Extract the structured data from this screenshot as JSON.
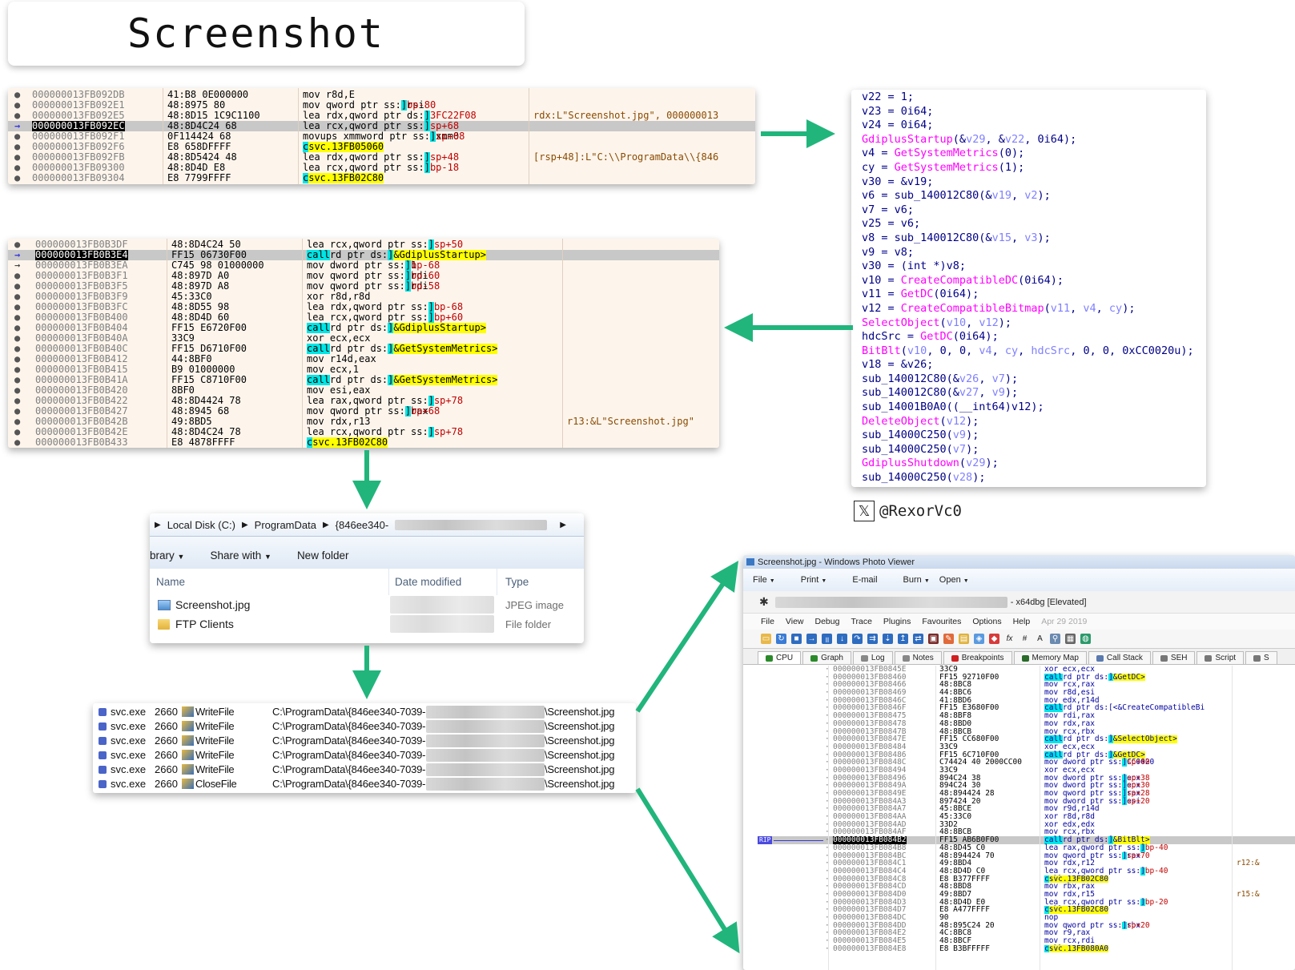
{
  "title": "Screenshot",
  "colors": {
    "arrow": "#21b57c",
    "cyan_highlight": "#00e5e5",
    "yellow_highlight": "#ffff00",
    "func_magenta": "#ff00ff",
    "var_blue": "#8080ff"
  },
  "debugger_top": {
    "rows": [
      {
        "addr": "000000013FB092DB",
        "bytes": "41:B8 0E000000",
        "ins": "mov r8d,E",
        "cmt": ""
      },
      {
        "addr": "000000013FB092E1",
        "bytes": "48:8975 80",
        "ins": "mov qword ptr ss:[rbp-80],rsi",
        "cmt": ""
      },
      {
        "addr": "000000013FB092E5",
        "bytes": "48:8D15 1C9C1100",
        "ins": "lea rdx,qword ptr ds:[13FC22F08]",
        "cmt": "rdx:L\"Screenshot.jpg\", 000000013"
      },
      {
        "addr": "000000013FB092EC",
        "bytes": "48:8D4C24 68",
        "ins": "lea rcx,qword ptr ss:[rsp+68]",
        "cmt": ""
      },
      {
        "addr": "000000013FB092F1",
        "bytes": "0F114424 68",
        "ins": "movups xmmword ptr ss:[rsp+68],xmm0",
        "cmt": ""
      },
      {
        "addr": "000000013FB092F6",
        "bytes": "E8 658DFFFF",
        "ins": "call svc.13FB05060",
        "cmt": ""
      },
      {
        "addr": "000000013FB092FB",
        "bytes": "48:8D5424 48",
        "ins": "lea rdx,qword ptr ss:[rsp+48]",
        "cmt": "[rsp+48]:L\"C:\\\\ProgramData\\\\{846"
      },
      {
        "addr": "000000013FB09300",
        "bytes": "48:8D4D E8",
        "ins": "lea rcx,qword ptr ss:[rbp-18]",
        "cmt": ""
      },
      {
        "addr": "000000013FB09304",
        "bytes": "E8 7799FFFF",
        "ins": "call svc.13FB02C80",
        "cmt": ""
      }
    ]
  },
  "debugger_mid": {
    "rows": [
      {
        "addr": "000000013FB0B3DF",
        "bytes": "48:8D4C24 50",
        "ins": "lea rcx,qword ptr ss:[rsp+50]",
        "cmt": ""
      },
      {
        "addr": "000000013FB0B3E4",
        "bytes": "FF15 06730F00",
        "ins": "call qword ptr ds:[<&GdiplusStartup>]",
        "cmt": ""
      },
      {
        "addr": "000000013FB0B3EA",
        "bytes": "C745 98 01000000",
        "ins": "mov dword ptr ss:[rbp-68],1",
        "cmt": ""
      },
      {
        "addr": "000000013FB0B3F1",
        "bytes": "48:897D A0",
        "ins": "mov qword ptr ss:[rbp-60],rdi",
        "cmt": ""
      },
      {
        "addr": "000000013FB0B3F5",
        "bytes": "48:897D A8",
        "ins": "mov qword ptr ss:[rbp-58],rdi",
        "cmt": ""
      },
      {
        "addr": "000000013FB0B3F9",
        "bytes": "45:33C0",
        "ins": "xor r8d,r8d",
        "cmt": ""
      },
      {
        "addr": "000000013FB0B3FC",
        "bytes": "48:8D55 98",
        "ins": "lea rdx,qword ptr ss:[rbp-68]",
        "cmt": ""
      },
      {
        "addr": "000000013FB0B400",
        "bytes": "48:8D4D 60",
        "ins": "lea rcx,qword ptr ss:[rbp+60]",
        "cmt": ""
      },
      {
        "addr": "000000013FB0B404",
        "bytes": "FF15 E6720F00",
        "ins": "call qword ptr ds:[<&GdiplusStartup>]",
        "cmt": ""
      },
      {
        "addr": "000000013FB0B40A",
        "bytes": "33C9",
        "ins": "xor ecx,ecx",
        "cmt": ""
      },
      {
        "addr": "000000013FB0B40C",
        "bytes": "FF15 D6710F00",
        "ins": "call qword ptr ds:[<&GetSystemMetrics>]",
        "cmt": ""
      },
      {
        "addr": "000000013FB0B412",
        "bytes": "44:8BF0",
        "ins": "mov r14d,eax",
        "cmt": ""
      },
      {
        "addr": "000000013FB0B415",
        "bytes": "B9 01000000",
        "ins": "mov ecx,1",
        "cmt": ""
      },
      {
        "addr": "000000013FB0B41A",
        "bytes": "FF15 C8710F00",
        "ins": "call qword ptr ds:[<&GetSystemMetrics>]",
        "cmt": ""
      },
      {
        "addr": "000000013FB0B420",
        "bytes": "8BF0",
        "ins": "mov esi,eax",
        "cmt": ""
      },
      {
        "addr": "000000013FB0B422",
        "bytes": "48:8D4424 78",
        "ins": "lea rax,qword ptr ss:[rsp+78]",
        "cmt": ""
      },
      {
        "addr": "000000013FB0B427",
        "bytes": "48:8945 68",
        "ins": "mov qword ptr ss:[rbp+68],rax",
        "cmt": ""
      },
      {
        "addr": "000000013FB0B42B",
        "bytes": "49:8BD5",
        "ins": "mov rdx,r13",
        "cmt": "r13:&L\"Screenshot.jpg\""
      },
      {
        "addr": "000000013FB0B42E",
        "bytes": "48:8D4C24 78",
        "ins": "lea rcx,qword ptr ss:[rsp+78]",
        "cmt": ""
      },
      {
        "addr": "000000013FB0B433",
        "bytes": "E8 4878FFFF",
        "ins": "call svc.13FB02C80",
        "cmt": ""
      }
    ]
  },
  "pseudocode": [
    "v22 = 1;",
    "v23 = 0i64;",
    "v24 = 0i64;",
    "GdiplusStartup(&v29, &v22, 0i64);",
    "v4 = GetSystemMetrics(0);",
    "cy = GetSystemMetrics(1);",
    "v30 = &v19;",
    "v6 = sub_140012C80(&v19, v2);",
    "v7 = v6;",
    "v25 = v6;",
    "v8 = sub_140012C80(&v15, v3);",
    "v9 = v8;",
    "v30 = (int *)v8;",
    "v10 = CreateCompatibleDC(0i64);",
    "v11 = GetDC(0i64);",
    "v12 = CreateCompatibleBitmap(v11, v4, cy);",
    "SelectObject(v10, v12);",
    "hdcSrc = GetDC(0i64);",
    "BitBlt(v10, 0, 0, v4, cy, hdcSrc, 0, 0, 0xCC0020u);",
    "v18 = &v26;",
    "sub_140012C80(&v26, v7);",
    "sub_140012C80(&v27, v9);",
    "sub_14001B0A0((__int64)v12);",
    "DeleteObject(v12);",
    "sub_14000C250(v9);",
    "sub_14000C250(v7);",
    "GdiplusShutdown(v29);",
    "sub_14000C250(v28);"
  ],
  "twitter_handle": "@RexorVc0",
  "explorer": {
    "breadcrumb": [
      "Local Disk (C:)",
      "ProgramData",
      "{846ee340-"
    ],
    "toolbar": {
      "library": "brary",
      "share": "Share with",
      "new_folder": "New folder"
    },
    "columns": {
      "name": "Name",
      "date": "Date modified",
      "type": "Type"
    },
    "files": [
      {
        "name": "Screenshot.jpg",
        "type": "JPEG image",
        "icon": "image-file-icon"
      },
      {
        "name": "FTP Clients",
        "type": "File folder",
        "icon": "folder-icon"
      }
    ]
  },
  "procmon": {
    "rows": [
      {
        "proc": "svc.exe",
        "pid": "2660",
        "op": "WriteFile",
        "path": "C:\\ProgramData\\{846ee340-7039-",
        "file": "\\Screenshot.jpg"
      },
      {
        "proc": "svc.exe",
        "pid": "2660",
        "op": "WriteFile",
        "path": "C:\\ProgramData\\{846ee340-7039-",
        "file": "\\Screenshot.jpg"
      },
      {
        "proc": "svc.exe",
        "pid": "2660",
        "op": "WriteFile",
        "path": "C:\\ProgramData\\{846ee340-7039-",
        "file": "\\Screenshot.jpg"
      },
      {
        "proc": "svc.exe",
        "pid": "2660",
        "op": "WriteFile",
        "path": "C:\\ProgramData\\{846ee340-7039-",
        "file": "\\Screenshot.jpg"
      },
      {
        "proc": "svc.exe",
        "pid": "2660",
        "op": "WriteFile",
        "path": "C:\\ProgramData\\{846ee340-7039-",
        "file": "\\Screenshot.jpg"
      },
      {
        "proc": "svc.exe",
        "pid": "2660",
        "op": "CloseFile",
        "path": "C:\\ProgramData\\{846ee340-7039-",
        "file": "\\Screenshot.jpg"
      }
    ]
  },
  "photo_viewer": {
    "title": "Screenshot.jpg - Windows Photo Viewer",
    "menu": [
      "File",
      "Print",
      "E-mail",
      "Burn",
      "Open"
    ],
    "x64dbg_title": "- x64dbg [Elevated]",
    "x64dbg_menu": [
      "File",
      "View",
      "Debug",
      "Trace",
      "Plugins",
      "Favourites",
      "Options",
      "Help",
      "Apr 29 2019"
    ],
    "tabs": [
      "CPU",
      "Graph",
      "Log",
      "Notes",
      "Breakpoints",
      "Memory Map",
      "Call Stack",
      "SEH",
      "Script",
      "S"
    ],
    "rip_label": "RIP",
    "rows": [
      {
        "addr": "000000013FB0845E",
        "bytes": "33C9",
        "ins": "xor ecx,ecx",
        "cmt": ""
      },
      {
        "addr": "000000013FB08460",
        "bytes": "FF15 92710F00",
        "ins": "call qword ptr ds:[<&GetDC>]",
        "cmt": ""
      },
      {
        "addr": "000000013FB08466",
        "bytes": "48:8BC8",
        "ins": "mov rcx,rax",
        "cmt": ""
      },
      {
        "addr": "000000013FB08469",
        "bytes": "44:8BC6",
        "ins": "mov r8d,esi",
        "cmt": ""
      },
      {
        "addr": "000000013FB0846C",
        "bytes": "41:8BD6",
        "ins": "mov edx,r14d",
        "cmt": ""
      },
      {
        "addr": "000000013FB0846F",
        "bytes": "FF15 E3680F00",
        "ins": "call qword ptr ds:[<&CreateCompatibleBi",
        "cmt": ""
      },
      {
        "addr": "000000013FB08475",
        "bytes": "48:8BF8",
        "ins": "mov rdi,rax",
        "cmt": ""
      },
      {
        "addr": "000000013FB08478",
        "bytes": "48:8BD0",
        "ins": "mov rdx,rax",
        "cmt": ""
      },
      {
        "addr": "000000013FB0847B",
        "bytes": "48:8BCB",
        "ins": "mov rcx,rbx",
        "cmt": ""
      },
      {
        "addr": "000000013FB0847E",
        "bytes": "FF15 CC680F00",
        "ins": "call qword ptr ds:[<&SelectObject>]",
        "cmt": ""
      },
      {
        "addr": "000000013FB08484",
        "bytes": "33C9",
        "ins": "xor ecx,ecx",
        "cmt": ""
      },
      {
        "addr": "000000013FB08486",
        "bytes": "FF15 6C710F00",
        "ins": "call qword ptr ds:[<&GetDC>]",
        "cmt": ""
      },
      {
        "addr": "000000013FB0848C",
        "bytes": "C74424 40 2000CC00",
        "ins": "mov dword ptr ss:[rsp+40],CC0020",
        "cmt": ""
      },
      {
        "addr": "000000013FB08494",
        "bytes": "33C9",
        "ins": "xor ecx,ecx",
        "cmt": ""
      },
      {
        "addr": "000000013FB08496",
        "bytes": "894C24 38",
        "ins": "mov dword ptr ss:[rsp+38],ecx",
        "cmt": ""
      },
      {
        "addr": "000000013FB0849A",
        "bytes": "894C24 30",
        "ins": "mov dword ptr ss:[rsp+30],ecx",
        "cmt": ""
      },
      {
        "addr": "000000013FB0849E",
        "bytes": "48:894424 28",
        "ins": "mov qword ptr ss:[rsp+28],rax",
        "cmt": ""
      },
      {
        "addr": "000000013FB084A3",
        "bytes": "897424 20",
        "ins": "mov dword ptr ss:[rsp+20],esi",
        "cmt": ""
      },
      {
        "addr": "000000013FB084A7",
        "bytes": "45:8BCE",
        "ins": "mov r9d,r14d",
        "cmt": ""
      },
      {
        "addr": "000000013FB084AA",
        "bytes": "45:33C0",
        "ins": "xor r8d,r8d",
        "cmt": ""
      },
      {
        "addr": "000000013FB084AD",
        "bytes": "33D2",
        "ins": "xor edx,edx",
        "cmt": ""
      },
      {
        "addr": "000000013FB084AF",
        "bytes": "48:8BCB",
        "ins": "mov rcx,rbx",
        "cmt": ""
      },
      {
        "addr": "000000013FB084B2",
        "bytes": "FF15 AB6B0F00",
        "ins": "call qword ptr ds:[<&BitBlt>]",
        "cmt": ""
      },
      {
        "addr": "000000013FB084B8",
        "bytes": "48:8D45 C0",
        "ins": "lea rax,qword ptr ss:[rbp-40]",
        "cmt": ""
      },
      {
        "addr": "000000013FB084BC",
        "bytes": "48:894424 70",
        "ins": "mov qword ptr ss:[rsp+70],rax",
        "cmt": ""
      },
      {
        "addr": "000000013FB084C1",
        "bytes": "49:8BD4",
        "ins": "mov rdx,r12",
        "cmt": "r12:&"
      },
      {
        "addr": "000000013FB084C4",
        "bytes": "48:8D4D C0",
        "ins": "lea rcx,qword ptr ss:[rbp-40]",
        "cmt": ""
      },
      {
        "addr": "000000013FB084C8",
        "bytes": "E8 B377FFFF",
        "ins": "call svc.13FB02C80",
        "cmt": ""
      },
      {
        "addr": "000000013FB084CD",
        "bytes": "48:8BD8",
        "ins": "mov rbx,rax",
        "cmt": ""
      },
      {
        "addr": "000000013FB084D0",
        "bytes": "49:8BD7",
        "ins": "mov rdx,r15",
        "cmt": "r15:&"
      },
      {
        "addr": "000000013FB084D3",
        "bytes": "48:8D4D E0",
        "ins": "lea rcx,qword ptr ss:[rbp-20]",
        "cmt": ""
      },
      {
        "addr": "000000013FB084D7",
        "bytes": "E8 A477FFFF",
        "ins": "call svc.13FB02C80",
        "cmt": ""
      },
      {
        "addr": "000000013FB084DC",
        "bytes": "90",
        "ins": "nop",
        "cmt": ""
      },
      {
        "addr": "000000013FB084DD",
        "bytes": "48:895C24 20",
        "ins": "mov qword ptr ss:[rsp+20],rbx",
        "cmt": ""
      },
      {
        "addr": "000000013FB084E2",
        "bytes": "4C:8BC8",
        "ins": "mov r9,rax",
        "cmt": ""
      },
      {
        "addr": "000000013FB084E5",
        "bytes": "48:8BCF",
        "ins": "mov rcx,rdi",
        "cmt": ""
      },
      {
        "addr": "000000013FB084E8",
        "bytes": "E8 B3BFFFFF",
        "ins": "call svc.13FB080A0",
        "cmt": ""
      }
    ]
  }
}
